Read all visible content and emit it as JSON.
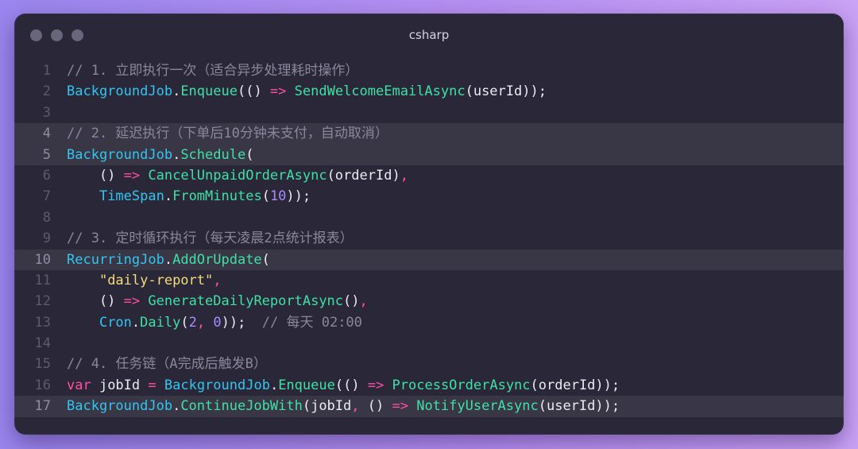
{
  "window": {
    "title": "csharp",
    "traffic_lights": [
      "close-dot",
      "minimize-dot",
      "zoom-dot"
    ]
  },
  "colors": {
    "comment": "#8a879c",
    "class": "#32c5f0",
    "method": "#3fe0a6",
    "operator": "#ff4fa3",
    "string": "#f4dd7a",
    "number": "#a68bff",
    "plain": "#ecebf3"
  },
  "lines": [
    {
      "n": "1",
      "hl": false,
      "tokens": [
        {
          "t": "cm",
          "v": "// 1. 立即执行一次（适合异步处理耗时操作）"
        }
      ]
    },
    {
      "n": "2",
      "hl": false,
      "tokens": [
        {
          "t": "cls",
          "v": "BackgroundJob"
        },
        {
          "t": "pl",
          "v": "."
        },
        {
          "t": "mth",
          "v": "Enqueue"
        },
        {
          "t": "pl",
          "v": "(() "
        },
        {
          "t": "op",
          "v": "=>"
        },
        {
          "t": "pl",
          "v": " "
        },
        {
          "t": "mth",
          "v": "SendWelcomeEmailAsync"
        },
        {
          "t": "pl",
          "v": "(userId));"
        }
      ]
    },
    {
      "n": "3",
      "hl": false,
      "tokens": []
    },
    {
      "n": "4",
      "hl": true,
      "tokens": [
        {
          "t": "cm",
          "v": "// 2. 延迟执行（下单后10分钟未支付，自动取消）"
        }
      ]
    },
    {
      "n": "5",
      "hl": true,
      "tokens": [
        {
          "t": "cls",
          "v": "BackgroundJob"
        },
        {
          "t": "pl",
          "v": "."
        },
        {
          "t": "mth",
          "v": "Schedule"
        },
        {
          "t": "pl",
          "v": "("
        }
      ]
    },
    {
      "n": "6",
      "hl": false,
      "tokens": [
        {
          "t": "pl",
          "v": "    () "
        },
        {
          "t": "op",
          "v": "=>"
        },
        {
          "t": "pl",
          "v": " "
        },
        {
          "t": "mth",
          "v": "CancelUnpaidOrderAsync"
        },
        {
          "t": "pl",
          "v": "(orderId)"
        },
        {
          "t": "op",
          "v": ","
        }
      ]
    },
    {
      "n": "7",
      "hl": false,
      "tokens": [
        {
          "t": "pl",
          "v": "    "
        },
        {
          "t": "cls",
          "v": "TimeSpan"
        },
        {
          "t": "pl",
          "v": "."
        },
        {
          "t": "mth",
          "v": "FromMinutes"
        },
        {
          "t": "pl",
          "v": "("
        },
        {
          "t": "num",
          "v": "10"
        },
        {
          "t": "pl",
          "v": "));"
        }
      ]
    },
    {
      "n": "8",
      "hl": false,
      "tokens": []
    },
    {
      "n": "9",
      "hl": false,
      "tokens": [
        {
          "t": "cm",
          "v": "// 3. 定时循环执行（每天凌晨2点统计报表）"
        }
      ]
    },
    {
      "n": "10",
      "hl": true,
      "tokens": [
        {
          "t": "cls",
          "v": "RecurringJob"
        },
        {
          "t": "pl",
          "v": "."
        },
        {
          "t": "mth",
          "v": "AddOrUpdate"
        },
        {
          "t": "pl",
          "v": "("
        }
      ]
    },
    {
      "n": "11",
      "hl": false,
      "tokens": [
        {
          "t": "pl",
          "v": "    "
        },
        {
          "t": "str",
          "v": "\"daily-report\""
        },
        {
          "t": "op",
          "v": ","
        }
      ]
    },
    {
      "n": "12",
      "hl": false,
      "tokens": [
        {
          "t": "pl",
          "v": "    () "
        },
        {
          "t": "op",
          "v": "=>"
        },
        {
          "t": "pl",
          "v": " "
        },
        {
          "t": "mth",
          "v": "GenerateDailyReportAsync"
        },
        {
          "t": "pl",
          "v": "()"
        },
        {
          "t": "op",
          "v": ","
        }
      ]
    },
    {
      "n": "13",
      "hl": false,
      "tokens": [
        {
          "t": "pl",
          "v": "    "
        },
        {
          "t": "cls",
          "v": "Cron"
        },
        {
          "t": "pl",
          "v": "."
        },
        {
          "t": "mth",
          "v": "Daily"
        },
        {
          "t": "pl",
          "v": "("
        },
        {
          "t": "num",
          "v": "2"
        },
        {
          "t": "op",
          "v": ","
        },
        {
          "t": "pl",
          "v": " "
        },
        {
          "t": "num",
          "v": "0"
        },
        {
          "t": "pl",
          "v": "));  "
        },
        {
          "t": "cm",
          "v": "// 每天 02:00"
        }
      ]
    },
    {
      "n": "14",
      "hl": false,
      "tokens": []
    },
    {
      "n": "15",
      "hl": false,
      "tokens": [
        {
          "t": "cm",
          "v": "// 4. 任务链（A完成后触发B）"
        }
      ]
    },
    {
      "n": "16",
      "hl": false,
      "tokens": [
        {
          "t": "kw",
          "v": "var"
        },
        {
          "t": "pl",
          "v": " jobId "
        },
        {
          "t": "op",
          "v": "="
        },
        {
          "t": "pl",
          "v": " "
        },
        {
          "t": "cls",
          "v": "BackgroundJob"
        },
        {
          "t": "pl",
          "v": "."
        },
        {
          "t": "mth",
          "v": "Enqueue"
        },
        {
          "t": "pl",
          "v": "(() "
        },
        {
          "t": "op",
          "v": "=>"
        },
        {
          "t": "pl",
          "v": " "
        },
        {
          "t": "mth",
          "v": "ProcessOrderAsync"
        },
        {
          "t": "pl",
          "v": "(orderId));"
        }
      ]
    },
    {
      "n": "17",
      "hl": true,
      "tokens": [
        {
          "t": "cls",
          "v": "BackgroundJob"
        },
        {
          "t": "pl",
          "v": "."
        },
        {
          "t": "mth",
          "v": "ContinueJobWith"
        },
        {
          "t": "pl",
          "v": "(jobId"
        },
        {
          "t": "op",
          "v": ","
        },
        {
          "t": "pl",
          "v": " () "
        },
        {
          "t": "op",
          "v": "=>"
        },
        {
          "t": "pl",
          "v": " "
        },
        {
          "t": "mth",
          "v": "NotifyUserAsync"
        },
        {
          "t": "pl",
          "v": "(userId));"
        }
      ]
    }
  ]
}
